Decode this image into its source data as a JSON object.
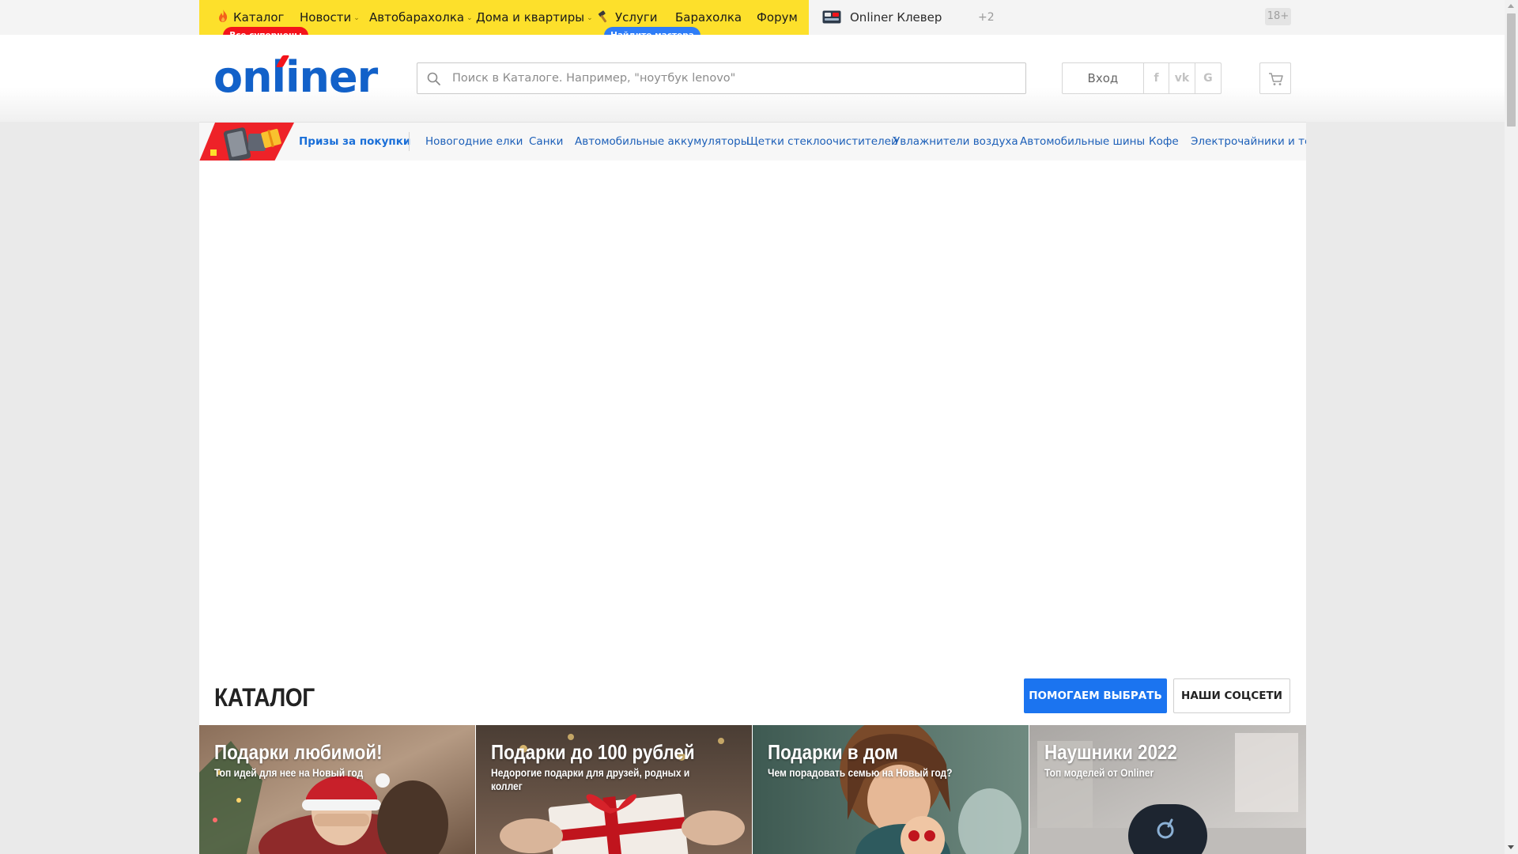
{
  "top_nav": {
    "items": [
      {
        "label": "Каталог"
      },
      {
        "label": "Новости",
        "caret": "⌄"
      },
      {
        "label": "Автобарахолка",
        "caret": "⌄"
      },
      {
        "label": "Дома и квартиры",
        "caret": "⌄"
      },
      {
        "label": "Услуги"
      },
      {
        "label": "Барахолка"
      },
      {
        "label": "Форум"
      }
    ],
    "catalog_badge": "Все суперцены",
    "services_badge": "Найдите мастера",
    "clever_label": "Onliner Клевер",
    "extra_count": "+2",
    "age_limit": "18+",
    "colors": {
      "yellow": "#fde02b",
      "red_badge": "#f3141b",
      "blue_badge": "#2f7df6"
    }
  },
  "header": {
    "logo_text": "onliner",
    "search": {
      "placeholder": "Поиск в Каталоге. Например, \"ноутбук lenovo\"",
      "value": ""
    },
    "login_label": "Вход",
    "social": [
      "f",
      "vk",
      "G"
    ],
    "icons": [
      "search-icon",
      "cart-icon",
      "facebook-icon",
      "vk-icon",
      "google-icon"
    ]
  },
  "promo_strip": {
    "prizes_label": "Призы за покупки",
    "categories": [
      "Новогодние елки",
      "Санки",
      "Автомобильные аккумуляторы",
      "Щетки стеклоочистителей",
      "Увлажнители воздуха",
      "Автомобильные шины",
      "Кофе",
      "Электрочайники и те"
    ]
  },
  "catalog": {
    "title": "КАТАЛОГ",
    "help_button": "ПОМОГАЕМ ВЫБРАТЬ",
    "social_button": "НАШИ СОЦСЕТИ",
    "accent": "#1b74f0",
    "tiles": [
      {
        "title": "Подарки любимой!",
        "subtitle": "Топ идей для нее на Новый год"
      },
      {
        "title": "Подарки до 100 рублей",
        "subtitle": "Недорогие подарки для друзей, родных и коллег"
      },
      {
        "title": "Подарки в дом",
        "subtitle": "Чем порадовать семью на Новый год?"
      },
      {
        "title": "Наушники 2022",
        "subtitle": "Топ моделей от Onliner"
      }
    ]
  }
}
